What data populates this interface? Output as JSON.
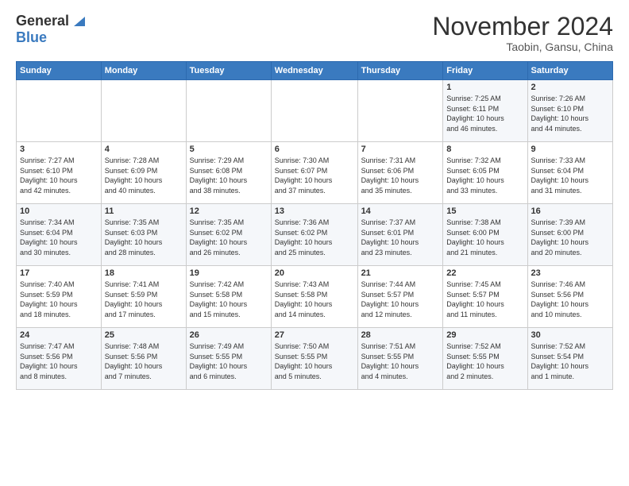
{
  "header": {
    "logo_general": "General",
    "logo_blue": "Blue",
    "title": "November 2024",
    "subtitle": "Taobin, Gansu, China"
  },
  "days_of_week": [
    "Sunday",
    "Monday",
    "Tuesday",
    "Wednesday",
    "Thursday",
    "Friday",
    "Saturday"
  ],
  "weeks": [
    [
      {
        "day": "",
        "info": ""
      },
      {
        "day": "",
        "info": ""
      },
      {
        "day": "",
        "info": ""
      },
      {
        "day": "",
        "info": ""
      },
      {
        "day": "",
        "info": ""
      },
      {
        "day": "1",
        "info": "Sunrise: 7:25 AM\nSunset: 6:11 PM\nDaylight: 10 hours\nand 46 minutes."
      },
      {
        "day": "2",
        "info": "Sunrise: 7:26 AM\nSunset: 6:10 PM\nDaylight: 10 hours\nand 44 minutes."
      }
    ],
    [
      {
        "day": "3",
        "info": "Sunrise: 7:27 AM\nSunset: 6:10 PM\nDaylight: 10 hours\nand 42 minutes."
      },
      {
        "day": "4",
        "info": "Sunrise: 7:28 AM\nSunset: 6:09 PM\nDaylight: 10 hours\nand 40 minutes."
      },
      {
        "day": "5",
        "info": "Sunrise: 7:29 AM\nSunset: 6:08 PM\nDaylight: 10 hours\nand 38 minutes."
      },
      {
        "day": "6",
        "info": "Sunrise: 7:30 AM\nSunset: 6:07 PM\nDaylight: 10 hours\nand 37 minutes."
      },
      {
        "day": "7",
        "info": "Sunrise: 7:31 AM\nSunset: 6:06 PM\nDaylight: 10 hours\nand 35 minutes."
      },
      {
        "day": "8",
        "info": "Sunrise: 7:32 AM\nSunset: 6:05 PM\nDaylight: 10 hours\nand 33 minutes."
      },
      {
        "day": "9",
        "info": "Sunrise: 7:33 AM\nSunset: 6:04 PM\nDaylight: 10 hours\nand 31 minutes."
      }
    ],
    [
      {
        "day": "10",
        "info": "Sunrise: 7:34 AM\nSunset: 6:04 PM\nDaylight: 10 hours\nand 30 minutes."
      },
      {
        "day": "11",
        "info": "Sunrise: 7:35 AM\nSunset: 6:03 PM\nDaylight: 10 hours\nand 28 minutes."
      },
      {
        "day": "12",
        "info": "Sunrise: 7:35 AM\nSunset: 6:02 PM\nDaylight: 10 hours\nand 26 minutes."
      },
      {
        "day": "13",
        "info": "Sunrise: 7:36 AM\nSunset: 6:02 PM\nDaylight: 10 hours\nand 25 minutes."
      },
      {
        "day": "14",
        "info": "Sunrise: 7:37 AM\nSunset: 6:01 PM\nDaylight: 10 hours\nand 23 minutes."
      },
      {
        "day": "15",
        "info": "Sunrise: 7:38 AM\nSunset: 6:00 PM\nDaylight: 10 hours\nand 21 minutes."
      },
      {
        "day": "16",
        "info": "Sunrise: 7:39 AM\nSunset: 6:00 PM\nDaylight: 10 hours\nand 20 minutes."
      }
    ],
    [
      {
        "day": "17",
        "info": "Sunrise: 7:40 AM\nSunset: 5:59 PM\nDaylight: 10 hours\nand 18 minutes."
      },
      {
        "day": "18",
        "info": "Sunrise: 7:41 AM\nSunset: 5:59 PM\nDaylight: 10 hours\nand 17 minutes."
      },
      {
        "day": "19",
        "info": "Sunrise: 7:42 AM\nSunset: 5:58 PM\nDaylight: 10 hours\nand 15 minutes."
      },
      {
        "day": "20",
        "info": "Sunrise: 7:43 AM\nSunset: 5:58 PM\nDaylight: 10 hours\nand 14 minutes."
      },
      {
        "day": "21",
        "info": "Sunrise: 7:44 AM\nSunset: 5:57 PM\nDaylight: 10 hours\nand 12 minutes."
      },
      {
        "day": "22",
        "info": "Sunrise: 7:45 AM\nSunset: 5:57 PM\nDaylight: 10 hours\nand 11 minutes."
      },
      {
        "day": "23",
        "info": "Sunrise: 7:46 AM\nSunset: 5:56 PM\nDaylight: 10 hours\nand 10 minutes."
      }
    ],
    [
      {
        "day": "24",
        "info": "Sunrise: 7:47 AM\nSunset: 5:56 PM\nDaylight: 10 hours\nand 8 minutes."
      },
      {
        "day": "25",
        "info": "Sunrise: 7:48 AM\nSunset: 5:56 PM\nDaylight: 10 hours\nand 7 minutes."
      },
      {
        "day": "26",
        "info": "Sunrise: 7:49 AM\nSunset: 5:55 PM\nDaylight: 10 hours\nand 6 minutes."
      },
      {
        "day": "27",
        "info": "Sunrise: 7:50 AM\nSunset: 5:55 PM\nDaylight: 10 hours\nand 5 minutes."
      },
      {
        "day": "28",
        "info": "Sunrise: 7:51 AM\nSunset: 5:55 PM\nDaylight: 10 hours\nand 4 minutes."
      },
      {
        "day": "29",
        "info": "Sunrise: 7:52 AM\nSunset: 5:55 PM\nDaylight: 10 hours\nand 2 minutes."
      },
      {
        "day": "30",
        "info": "Sunrise: 7:52 AM\nSunset: 5:54 PM\nDaylight: 10 hours\nand 1 minute."
      }
    ]
  ]
}
